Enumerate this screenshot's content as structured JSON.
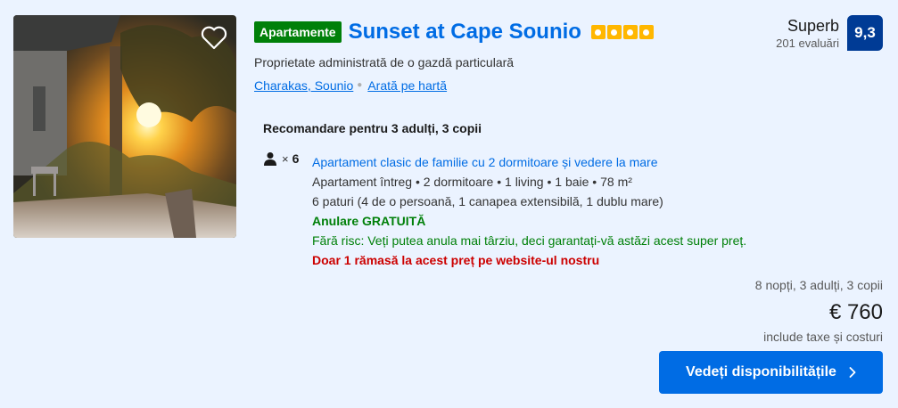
{
  "property": {
    "type_badge": "Apartamente",
    "name": "Sunset at Cape Sounio",
    "star_count": 4,
    "host": "Proprietate administrată de o gazdă particulară",
    "location_link": "Charakas, Sounio",
    "map_link": "Arată pe hartă",
    "favorite_icon": "heart-outline-icon",
    "photo_icon": "sunset-terrace-photo"
  },
  "review": {
    "word": "Superb",
    "count": "201 evaluări",
    "score": "9,3"
  },
  "recommendation": {
    "title": "Recomandare pentru 3 adulți, 3 copii",
    "occupancy_icon": "person-icon",
    "occupancy_times": "×",
    "occupancy_count": "6",
    "unit_name": "Apartament clasic de familie cu 2 dormitoare și vedere la mare",
    "unit_details": "Apartament întreg • 2 dormitoare • 1 living • 1 baie • 78 m²",
    "beds": "6 paturi (4 de o persoană, 1 canapea extensibilă, 1 dublu mare)",
    "cancellation": "Anulare GRATUITĂ",
    "no_risk": "Fără risc: Veți putea anula mai târziu, deci garantați-vă astăzi acest super preț.",
    "scarcity": "Doar 1 rămasă la acest preț pe website-ul nostru"
  },
  "price": {
    "stay": "8 nopți, 3 adulți, 3 copii",
    "amount": "€ 760",
    "taxes": "include taxe și costuri"
  },
  "cta": {
    "label": "Vedeți disponibilitățile",
    "icon": "chevron-right-icon"
  },
  "colors": {
    "brand_blue": "#006ce4",
    "score_blue": "#003b95",
    "green": "#008009",
    "red": "#cc0000",
    "star_yellow": "#ffb700",
    "background": "#ebf3ff"
  }
}
